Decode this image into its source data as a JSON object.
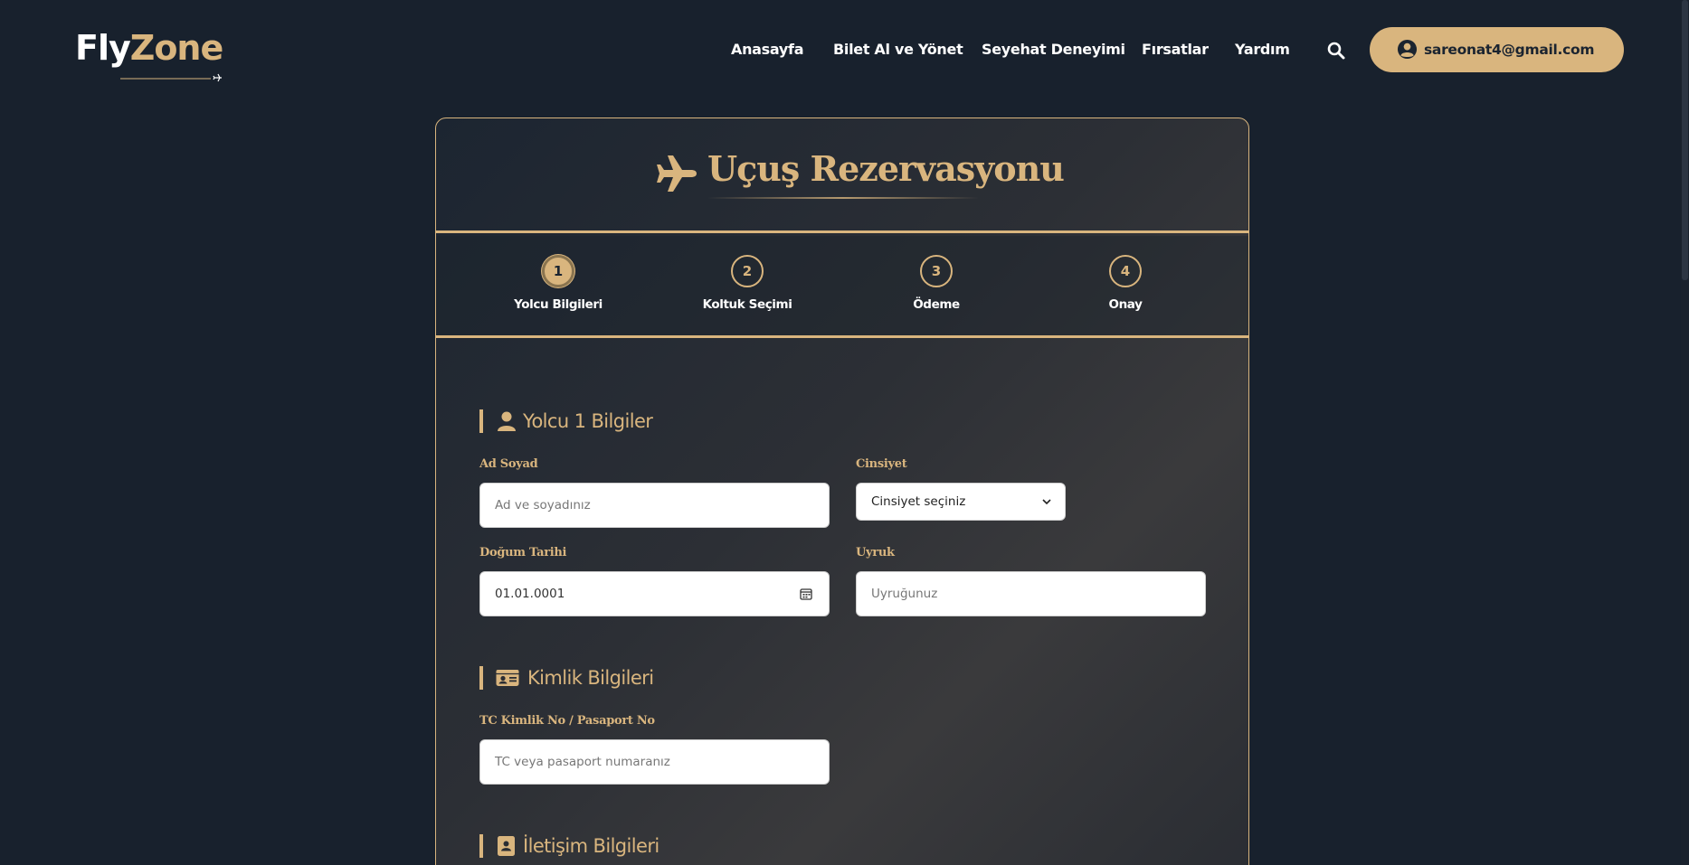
{
  "header": {
    "logo": {
      "part1": "Fly",
      "part2": "Zone"
    },
    "nav": [
      {
        "label": "Anasayfa"
      },
      {
        "label": "Bilet Al ve Yönet"
      },
      {
        "label": "Seyehat Deneyimi"
      },
      {
        "label": "Fırsatlar"
      },
      {
        "label": "Yardım"
      }
    ],
    "search_icon": "search-icon",
    "user": {
      "email": "sareonat4@gmail.com",
      "icon": "user-circle-icon"
    }
  },
  "card": {
    "title": "Uçuş Rezervasyonu",
    "title_icon": "plane-icon",
    "steps": [
      {
        "number": "1",
        "label": "Yolcu Bilgileri",
        "active": true
      },
      {
        "number": "2",
        "label": "Koltuk Seçimi",
        "active": false
      },
      {
        "number": "3",
        "label": "Ödeme",
        "active": false
      },
      {
        "number": "4",
        "label": "Onay",
        "active": false
      }
    ],
    "passenger_section": {
      "title": "Yolcu 1 Bilgiler",
      "icon": "user-icon",
      "name_label": "Ad Soyad",
      "name_placeholder": "Ad ve soyadınız",
      "gender_label": "Cinsiyet",
      "gender_selected": "Cinsiyet seçiniz",
      "birth_label": "Doğum Tarihi",
      "birth_value": "01.01.0001",
      "nationality_label": "Uyruk",
      "nationality_placeholder": "Uyruğunuz"
    },
    "identity_section": {
      "title": "Kimlik Bilgileri",
      "icon": "id-card-icon",
      "id_label": "TC Kimlik No / Pasaport No",
      "id_placeholder": "TC veya pasaport numaranız"
    },
    "contact_section": {
      "title": "İletişim Bilgileri",
      "icon": "address-book-icon"
    }
  },
  "colors": {
    "background": "#18212d",
    "accent": "#d9b57e",
    "text": "#ffffff"
  }
}
